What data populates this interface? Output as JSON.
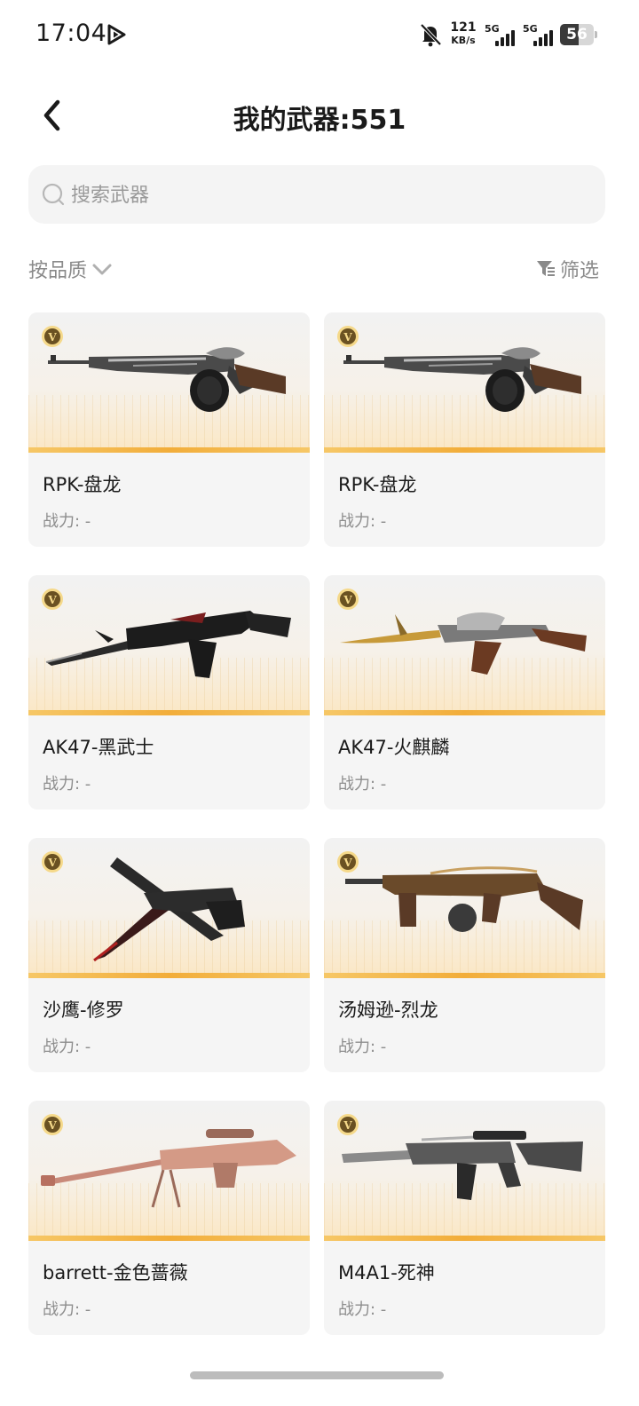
{
  "status_bar": {
    "time": "17:04",
    "net_speed_value": "121",
    "net_speed_unit": "KB/s",
    "signal1_label": "5G",
    "signal2_label": "5G",
    "battery_level": "56"
  },
  "header": {
    "title": "我的武器:551"
  },
  "search": {
    "placeholder": "搜索武器"
  },
  "toolbar": {
    "sort_label": "按品质",
    "filter_label": "筛选"
  },
  "weapons": [
    {
      "name": "RPK-盘龙",
      "power": "战力: -",
      "badge": "V"
    },
    {
      "name": "RPK-盘龙",
      "power": "战力: -",
      "badge": "V"
    },
    {
      "name": "AK47-黑武士",
      "power": "战力: -",
      "badge": "V"
    },
    {
      "name": "AK47-火麒麟",
      "power": "战力: -",
      "badge": "V"
    },
    {
      "name": "沙鹰-修罗",
      "power": "战力: -",
      "badge": "V"
    },
    {
      "name": "汤姆逊-烈龙",
      "power": "战力: -",
      "badge": "V"
    },
    {
      "name": "barrett-金色蔷薇",
      "power": "战力: -",
      "badge": "V"
    },
    {
      "name": "M4A1-死神",
      "power": "战力: -",
      "badge": "V"
    }
  ],
  "colors": {
    "accent_gold": "#f2ad3a",
    "card_background": "#f5f5f5",
    "muted_text": "#8a8a8a"
  }
}
